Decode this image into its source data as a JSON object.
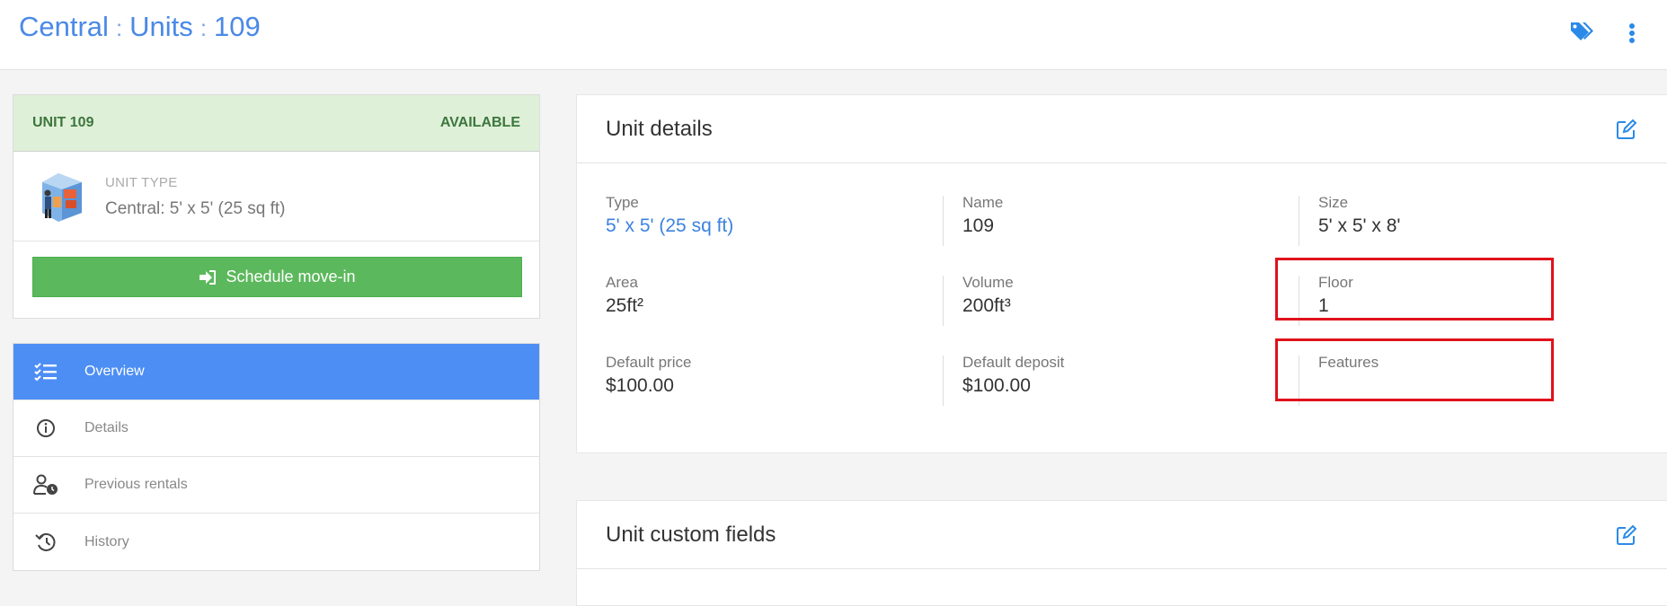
{
  "header": {
    "breadcrumb": [
      "Central",
      "Units",
      "109"
    ],
    "separator": ":",
    "tag_icon": "tags-icon",
    "menu_icon": "vertical-dots-icon"
  },
  "unit_card": {
    "unit_label": "UNIT 109",
    "status": "AVAILABLE",
    "type_label": "UNIT TYPE",
    "type_value": "Central: 5' x 5' (25 sq ft)",
    "move_in_label": "Schedule move-in"
  },
  "nav": {
    "items": [
      {
        "label": "Overview",
        "icon": "checklist-icon",
        "active": true
      },
      {
        "label": "Details",
        "icon": "info-icon",
        "active": false
      },
      {
        "label": "Previous rentals",
        "icon": "user-clock-icon",
        "active": false
      },
      {
        "label": "History",
        "icon": "history-icon",
        "active": false
      }
    ]
  },
  "unit_details": {
    "title": "Unit details",
    "fields": {
      "type": {
        "label": "Type",
        "value": "5' x 5' (25 sq ft)"
      },
      "name": {
        "label": "Name",
        "value": "109"
      },
      "size": {
        "label": "Size",
        "value": "5' x 5' x 8'"
      },
      "area": {
        "label": "Area",
        "value": "25ft²"
      },
      "volume": {
        "label": "Volume",
        "value": "200ft³"
      },
      "floor": {
        "label": "Floor",
        "value": "1"
      },
      "default_price": {
        "label": "Default price",
        "value": "$100.00"
      },
      "default_deposit": {
        "label": "Default deposit",
        "value": "$100.00"
      },
      "features": {
        "label": "Features",
        "value": ""
      }
    }
  },
  "custom_fields": {
    "title": "Unit custom fields"
  },
  "colors": {
    "accent": "#4a89e6",
    "active_nav": "#4d8ef5",
    "success": "#5cb85c",
    "available_bg": "#dff0d8",
    "highlight": "#e0121b"
  }
}
